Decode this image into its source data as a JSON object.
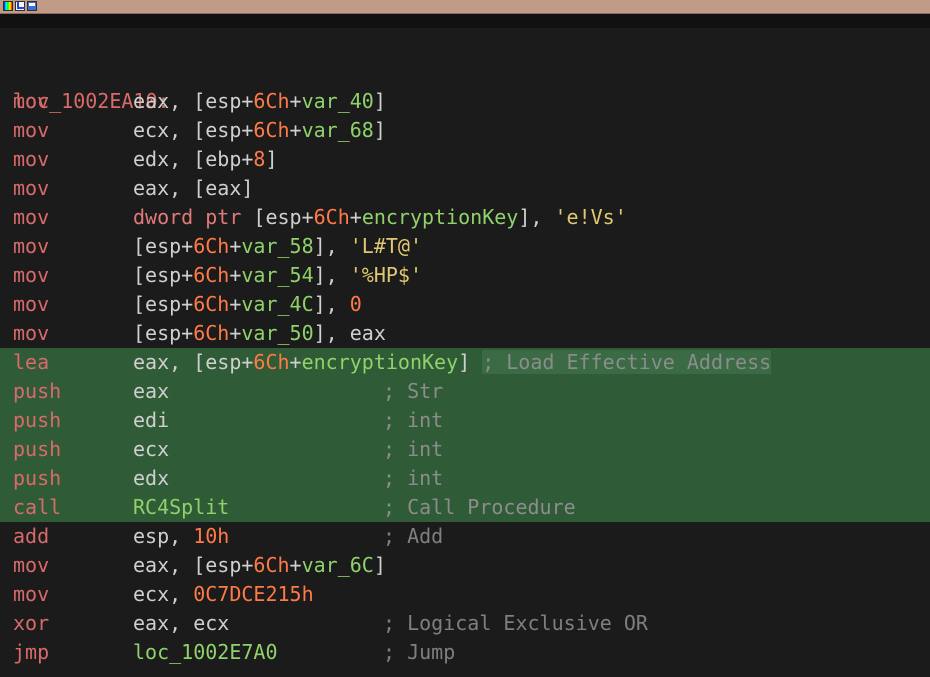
{
  "window": {
    "icons": [
      "palette-icon",
      "graph-icon",
      "image-icon"
    ]
  },
  "colors": {
    "background": "#1b1b1b",
    "titlebar_strip": "#c19a88",
    "highlight": "#2f5c37",
    "mnemonic": "#d86a6a",
    "register": "#cfcfcf",
    "number": "#ff7a45",
    "symbol": "#8fd16a",
    "string": "#e0c870",
    "comment": "#7f7f7f"
  },
  "disasm": {
    "label": "loc_1002EA10:",
    "lines": [
      {
        "mn": "mov",
        "ops": [
          {
            "t": "reg",
            "v": "eax, ["
          },
          {
            "t": "reg",
            "v": "esp"
          },
          {
            "t": "pun",
            "v": "+"
          },
          {
            "t": "num",
            "v": "6Ch"
          },
          {
            "t": "pun",
            "v": "+"
          },
          {
            "t": "sym",
            "v": "var_40"
          },
          {
            "t": "pun",
            "v": "]"
          }
        ]
      },
      {
        "mn": "mov",
        "ops": [
          {
            "t": "reg",
            "v": "ecx, ["
          },
          {
            "t": "reg",
            "v": "esp"
          },
          {
            "t": "pun",
            "v": "+"
          },
          {
            "t": "num",
            "v": "6Ch"
          },
          {
            "t": "pun",
            "v": "+"
          },
          {
            "t": "sym",
            "v": "var_68"
          },
          {
            "t": "pun",
            "v": "]"
          }
        ]
      },
      {
        "mn": "mov",
        "ops": [
          {
            "t": "reg",
            "v": "edx, ["
          },
          {
            "t": "reg",
            "v": "ebp"
          },
          {
            "t": "pun",
            "v": "+"
          },
          {
            "t": "num",
            "v": "8"
          },
          {
            "t": "pun",
            "v": "]"
          }
        ]
      },
      {
        "mn": "mov",
        "ops": [
          {
            "t": "reg",
            "v": "eax, [eax]"
          }
        ]
      },
      {
        "mn": "mov",
        "ops": [
          {
            "t": "kw",
            "v": "dword ptr "
          },
          {
            "t": "pun",
            "v": "["
          },
          {
            "t": "reg",
            "v": "esp"
          },
          {
            "t": "pun",
            "v": "+"
          },
          {
            "t": "num",
            "v": "6Ch"
          },
          {
            "t": "pun",
            "v": "+"
          },
          {
            "t": "sym",
            "v": "encryptionKey"
          },
          {
            "t": "pun",
            "v": "], "
          },
          {
            "t": "str",
            "v": "'e!Vs'"
          }
        ]
      },
      {
        "mn": "mov",
        "ops": [
          {
            "t": "pun",
            "v": "["
          },
          {
            "t": "reg",
            "v": "esp"
          },
          {
            "t": "pun",
            "v": "+"
          },
          {
            "t": "num",
            "v": "6Ch"
          },
          {
            "t": "pun",
            "v": "+"
          },
          {
            "t": "sym",
            "v": "var_58"
          },
          {
            "t": "pun",
            "v": "], "
          },
          {
            "t": "str",
            "v": "'L#T@'"
          }
        ]
      },
      {
        "mn": "mov",
        "ops": [
          {
            "t": "pun",
            "v": "["
          },
          {
            "t": "reg",
            "v": "esp"
          },
          {
            "t": "pun",
            "v": "+"
          },
          {
            "t": "num",
            "v": "6Ch"
          },
          {
            "t": "pun",
            "v": "+"
          },
          {
            "t": "sym",
            "v": "var_54"
          },
          {
            "t": "pun",
            "v": "], "
          },
          {
            "t": "str",
            "v": "'%HP$'"
          }
        ]
      },
      {
        "mn": "mov",
        "ops": [
          {
            "t": "pun",
            "v": "["
          },
          {
            "t": "reg",
            "v": "esp"
          },
          {
            "t": "pun",
            "v": "+"
          },
          {
            "t": "num",
            "v": "6Ch"
          },
          {
            "t": "pun",
            "v": "+"
          },
          {
            "t": "sym",
            "v": "var_4C"
          },
          {
            "t": "pun",
            "v": "], "
          },
          {
            "t": "num",
            "v": "0"
          }
        ]
      },
      {
        "mn": "mov",
        "ops": [
          {
            "t": "pun",
            "v": "["
          },
          {
            "t": "reg",
            "v": "esp"
          },
          {
            "t": "pun",
            "v": "+"
          },
          {
            "t": "num",
            "v": "6Ch"
          },
          {
            "t": "pun",
            "v": "+"
          },
          {
            "t": "sym",
            "v": "var_50"
          },
          {
            "t": "pun",
            "v": "], eax"
          }
        ]
      },
      {
        "mn": "lea",
        "hl": true,
        "ops": [
          {
            "t": "reg",
            "v": "eax, ["
          },
          {
            "t": "reg",
            "v": "esp"
          },
          {
            "t": "pun",
            "v": "+"
          },
          {
            "t": "num",
            "v": "6Ch"
          },
          {
            "t": "pun",
            "v": "+"
          },
          {
            "t": "sym",
            "v": "encryptionKey"
          },
          {
            "t": "pun",
            "v": "]"
          }
        ],
        "comment": "; Load Effective Address",
        "comment_left": "after"
      },
      {
        "mn": "push",
        "hl": true,
        "ops": [
          {
            "t": "reg",
            "v": "eax"
          }
        ],
        "comment": "; Str"
      },
      {
        "mn": "push",
        "hl": true,
        "ops": [
          {
            "t": "reg",
            "v": "edi"
          }
        ],
        "comment": "; int"
      },
      {
        "mn": "push",
        "hl": true,
        "ops": [
          {
            "t": "reg",
            "v": "ecx"
          }
        ],
        "comment": "; int"
      },
      {
        "mn": "push",
        "hl": true,
        "ops": [
          {
            "t": "reg",
            "v": "edx"
          }
        ],
        "comment": "; int"
      },
      {
        "mn": "call",
        "hl": true,
        "ops": [
          {
            "t": "sym",
            "v": "RC4Split"
          }
        ],
        "comment": "; Call Procedure"
      },
      {
        "mn": "add",
        "ops": [
          {
            "t": "reg",
            "v": "esp, "
          },
          {
            "t": "num",
            "v": "10h"
          }
        ],
        "comment": "; Add"
      },
      {
        "mn": "mov",
        "ops": [
          {
            "t": "reg",
            "v": "eax, ["
          },
          {
            "t": "reg",
            "v": "esp"
          },
          {
            "t": "pun",
            "v": "+"
          },
          {
            "t": "num",
            "v": "6Ch"
          },
          {
            "t": "pun",
            "v": "+"
          },
          {
            "t": "sym",
            "v": "var_6C"
          },
          {
            "t": "pun",
            "v": "]"
          }
        ]
      },
      {
        "mn": "mov",
        "ops": [
          {
            "t": "reg",
            "v": "ecx, "
          },
          {
            "t": "num",
            "v": "0C7DCE215h"
          }
        ]
      },
      {
        "mn": "xor",
        "ops": [
          {
            "t": "reg",
            "v": "eax, ecx"
          }
        ],
        "comment": "; Logical Exclusive OR"
      },
      {
        "mn": "jmp",
        "ops": [
          {
            "t": "sym",
            "v": "loc_1002E7A0"
          }
        ],
        "comment": "; Jump"
      }
    ]
  }
}
